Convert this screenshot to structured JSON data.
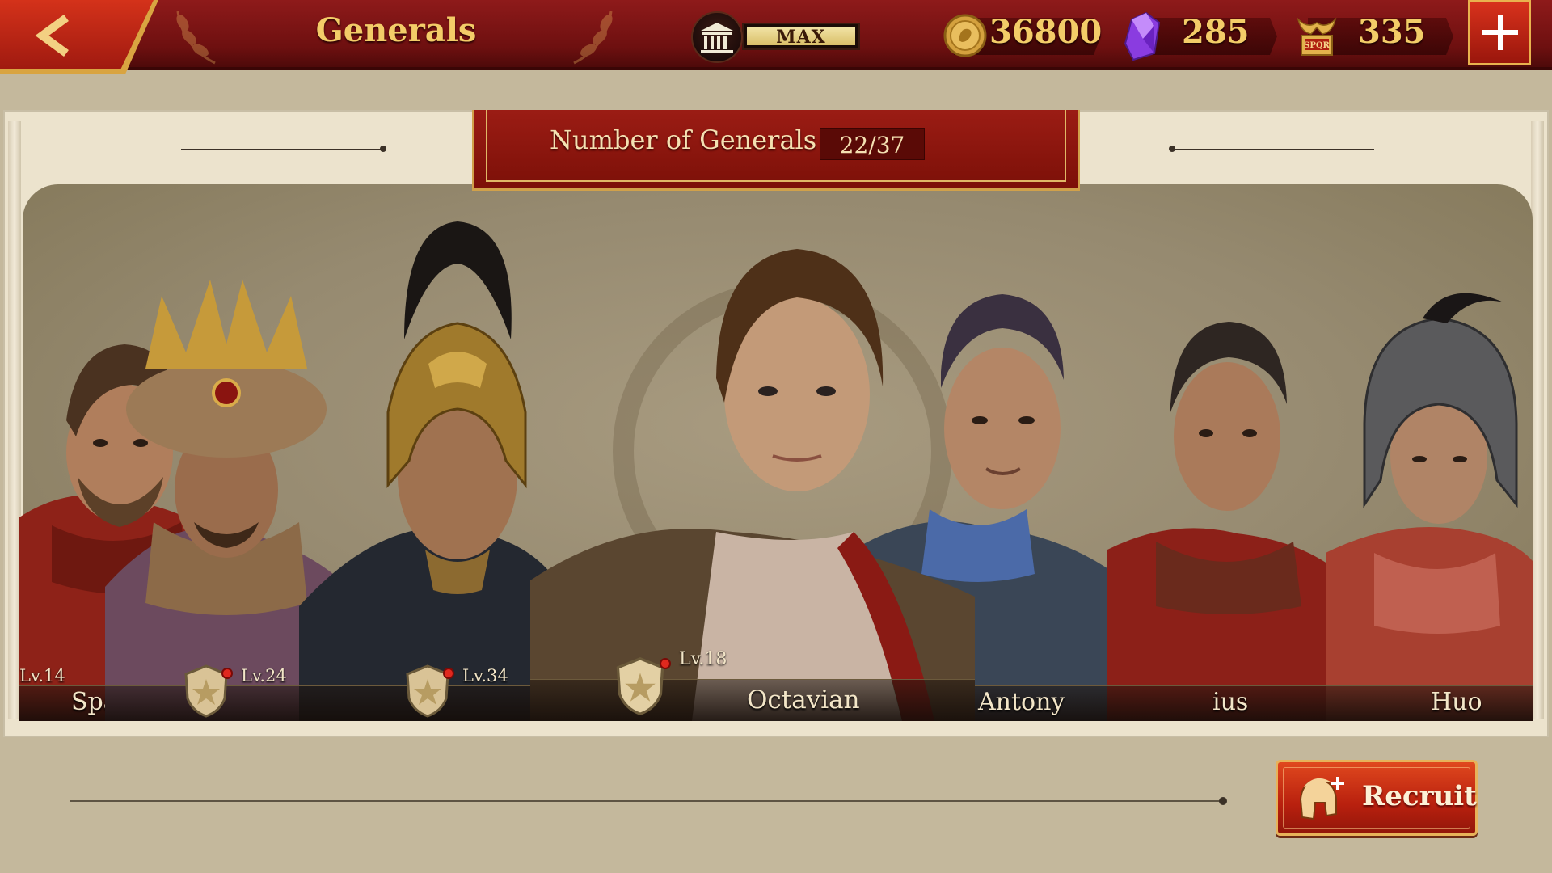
{
  "header": {
    "title": "Generals",
    "max_label": "MAX",
    "max_fill": 1.0,
    "resources": [
      {
        "icon": "gold-coin-icon",
        "value": "36800"
      },
      {
        "icon": "purple-gem-icon",
        "value": "285"
      },
      {
        "icon": "spqr-eagle-icon",
        "value": "335"
      }
    ]
  },
  "banner": {
    "label": "Number of Generals",
    "count": "22/37"
  },
  "generals": [
    {
      "name": "Spa",
      "level": "Lv.14",
      "badge": false
    },
    {
      "name": "",
      "level": "Lv.24",
      "badge": true
    },
    {
      "name": "",
      "level": "Lv.34",
      "badge": true
    },
    {
      "name": "Octavian",
      "level": "Lv.18",
      "badge": true
    },
    {
      "name": "Antony",
      "level": "",
      "badge": false
    },
    {
      "name": "ius",
      "level": "",
      "badge": false
    },
    {
      "name": "Huo",
      "level": "",
      "badge": false
    }
  ],
  "footer": {
    "recruit_label": "Recruit"
  },
  "colors": {
    "top_bar": "#7e1414",
    "gold_text": "#f3cc68",
    "panel_bg": "#ece3cd",
    "stage_bg": "#968a70",
    "recruit_button": "#c8300f"
  }
}
